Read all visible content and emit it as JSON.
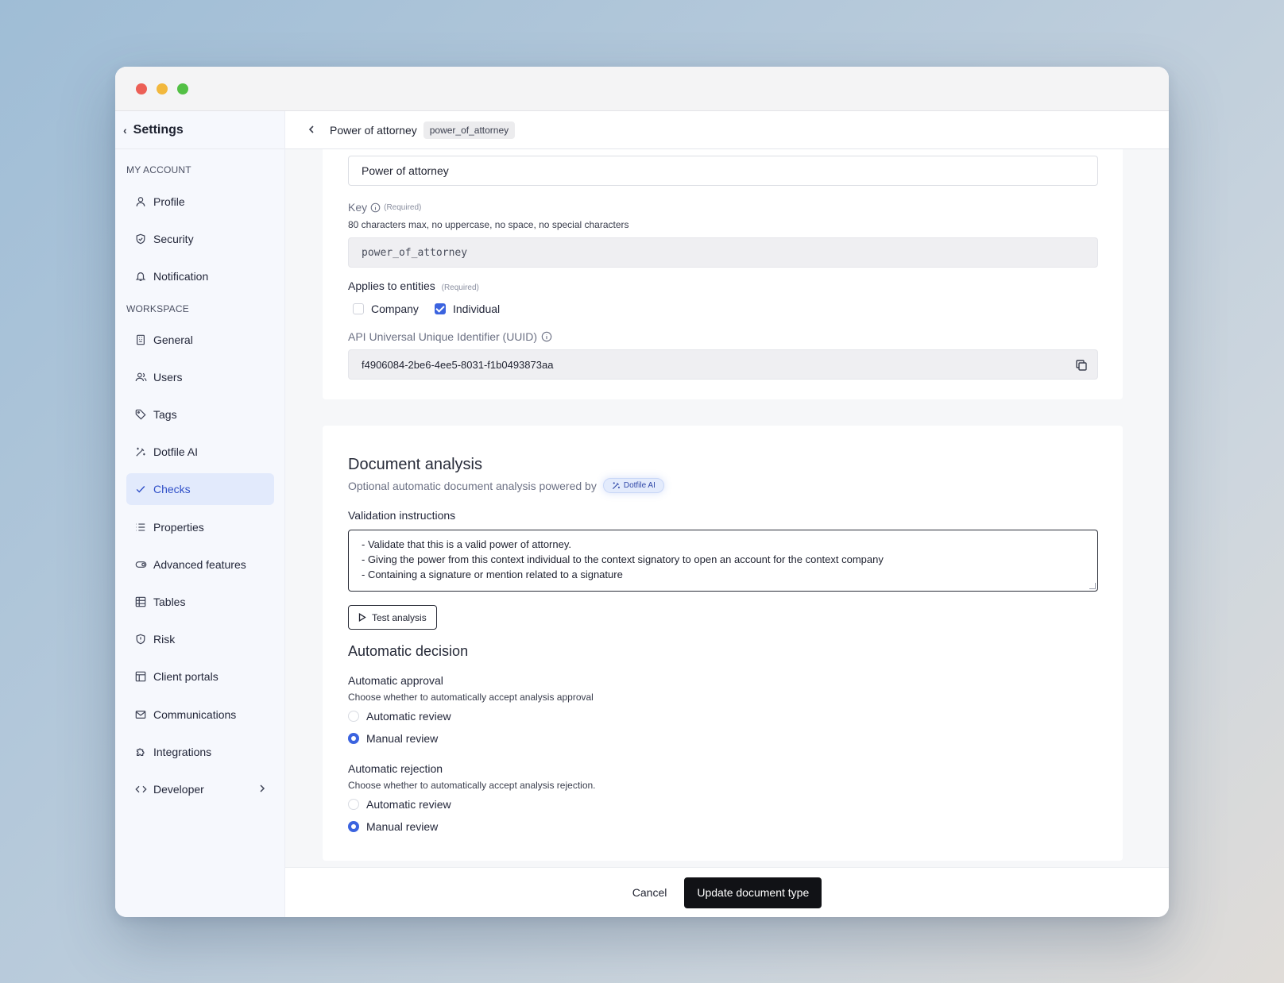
{
  "sidebar": {
    "title": "Settings",
    "sections": {
      "account": "MY ACCOUNT",
      "workspace": "WORKSPACE"
    },
    "items": [
      {
        "label": "Profile",
        "icon": "user-icon"
      },
      {
        "label": "Security",
        "icon": "shield-icon"
      },
      {
        "label": "Notification",
        "icon": "bell-icon"
      },
      {
        "label": "General",
        "icon": "building-icon"
      },
      {
        "label": "Users",
        "icon": "users-icon"
      },
      {
        "label": "Tags",
        "icon": "tag-icon"
      },
      {
        "label": "Dotfile AI",
        "icon": "magic-wand-icon"
      },
      {
        "label": "Checks",
        "icon": "check-icon",
        "active": true
      },
      {
        "label": "Properties",
        "icon": "list-icon"
      },
      {
        "label": "Advanced features",
        "icon": "toggle-icon"
      },
      {
        "label": "Tables",
        "icon": "table-icon"
      },
      {
        "label": "Risk",
        "icon": "risk-shield-icon"
      },
      {
        "label": "Client portals",
        "icon": "layout-icon"
      },
      {
        "label": "Communications",
        "icon": "mail-icon"
      },
      {
        "label": "Integrations",
        "icon": "puzzle-icon"
      },
      {
        "label": "Developer",
        "icon": "code-icon"
      }
    ]
  },
  "header": {
    "title": "Power of attorney",
    "key_chip": "power_of_attorney"
  },
  "form": {
    "name_value": "Power of attorney",
    "key_label": "Key",
    "required": "(Required)",
    "key_hint": "80 characters max, no uppercase, no space, no special characters",
    "key_value": "power_of_attorney",
    "entities_label": "Applies to entities",
    "entity_company": "Company",
    "entity_individual": "Individual",
    "uuid_label": "API Universal Unique Identifier (UUID)",
    "uuid_value": "f4906084-2be6-4ee5-8031-f1b0493873aa"
  },
  "analysis": {
    "title": "Document analysis",
    "subtitle": "Optional automatic document analysis powered by",
    "ai_badge": "Dotfile AI",
    "instructions_label": "Validation instructions",
    "instructions": [
      "- Validate that this is a valid power of attorney.",
      "- Giving the power from this context individual to the context signatory to open an account for the context company",
      "- Containing a signature or mention related to a signature"
    ],
    "test_button": "Test analysis"
  },
  "decision": {
    "title": "Automatic decision",
    "approval_label": "Automatic approval",
    "approval_hint": "Choose whether to automatically accept analysis approval",
    "rejection_label": "Automatic rejection",
    "rejection_hint": "Choose whether to automatically accept analysis rejection.",
    "option_auto": "Automatic review",
    "option_manual": "Manual review",
    "approval_selected": "Manual review",
    "rejection_selected": "Manual review"
  },
  "footer": {
    "cancel": "Cancel",
    "submit": "Update document type"
  },
  "colors": {
    "accent": "#3b63df",
    "active_bg": "#e2eafc",
    "primary_button": "#111216"
  }
}
